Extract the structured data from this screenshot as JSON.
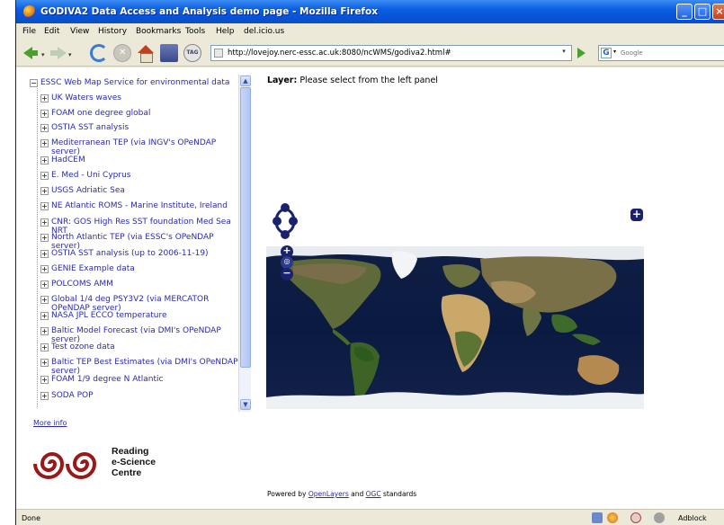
{
  "window": {
    "title": "GODIVA2 Data Access and Analysis demo page - Mozilla Firefox"
  },
  "menu": {
    "items": [
      "File",
      "Edit",
      "View",
      "History",
      "Bookmarks",
      "Tools",
      "Help",
      "del.icio.us"
    ]
  },
  "toolbar": {
    "url": "http://lovejoy.nerc-essc.ac.uk:8080/ncWMS/godiva2.html#",
    "search_placeholder": "Google"
  },
  "sidebar": {
    "root_label": "ESSC Web Map Service for environmental data",
    "items": [
      {
        "label": "UK Waters waves"
      },
      {
        "label": "FOAM one degree global"
      },
      {
        "label": "OSTIA SST analysis"
      },
      {
        "label": "Mediterranean TEP (via INGV's OPeNDAP server)"
      },
      {
        "label": "HadCEM"
      },
      {
        "label": "E. Med - Uni Cyprus"
      },
      {
        "label": "USGS Adriatic Sea"
      },
      {
        "label": "NE Atlantic ROMS - Marine Institute, Ireland"
      },
      {
        "label": "CNR: GOS High Res SST foundation Med Sea NRT"
      },
      {
        "label": "North Atlantic TEP (via ESSC's OPeNDAP server)"
      },
      {
        "label": "OSTIA SST analysis (up to 2006-11-19)"
      },
      {
        "label": "GENIE Example data"
      },
      {
        "label": "POLCOMS AMM"
      },
      {
        "label": "Global 1/4 deg PSY3V2 (via MERCATOR OPeNDAP server)"
      },
      {
        "label": "NASA JPL ECCO temperature"
      },
      {
        "label": "Baltic Model Forecast (via DMI's OPeNDAP server)"
      },
      {
        "label": "Test ozone data"
      },
      {
        "label": "Baltic TEP Best Estimates (via DMI's OPeNDAP server)"
      },
      {
        "label": "FOAM 1/9 degree N Atlantic"
      },
      {
        "label": "SODA POP"
      }
    ],
    "more_info": "More info",
    "logo_text": [
      "Reading",
      "e-Science",
      "Centre"
    ]
  },
  "main": {
    "layer_label": "Layer:",
    "layer_value": "Please select from the left panel",
    "powered_prefix": "Powered by",
    "powered_openlayers": "OpenLayers",
    "powered_and": "and",
    "powered_ogc": "OGC",
    "powered_suffix": "standards"
  },
  "status": {
    "text": "Done",
    "adblock": "Adblock"
  }
}
